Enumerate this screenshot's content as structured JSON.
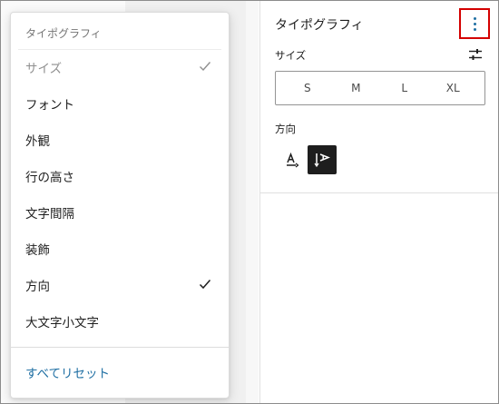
{
  "menu": {
    "header": "タイポグラフィ",
    "items": [
      {
        "label": "サイズ",
        "checked": true,
        "muted": true
      },
      {
        "label": "フォント",
        "checked": false,
        "muted": false
      },
      {
        "label": "外観",
        "checked": false,
        "muted": false
      },
      {
        "label": "行の高さ",
        "checked": false,
        "muted": false
      },
      {
        "label": "文字間隔",
        "checked": false,
        "muted": false
      },
      {
        "label": "装飾",
        "checked": false,
        "muted": false
      },
      {
        "label": "方向",
        "checked": true,
        "muted": false
      },
      {
        "label": "大文字小文字",
        "checked": false,
        "muted": false
      }
    ],
    "reset_label": "すべてリセット"
  },
  "panel": {
    "title": "タイポグラフィ",
    "size_label": "サイズ",
    "size_options": [
      "S",
      "M",
      "L",
      "XL"
    ],
    "direction_label": "方向",
    "direction_selected": "vertical"
  },
  "icons": {
    "options": "kebab-vertical-icon",
    "size_controls": "sliders-icon",
    "check": "checkmark-icon",
    "horizontal": "text-horizontal-icon",
    "vertical": "text-vertical-icon"
  },
  "colors": {
    "accent": "#1f6fa3",
    "highlight_border": "#d40000",
    "selected_bg": "#1e1e1e"
  }
}
